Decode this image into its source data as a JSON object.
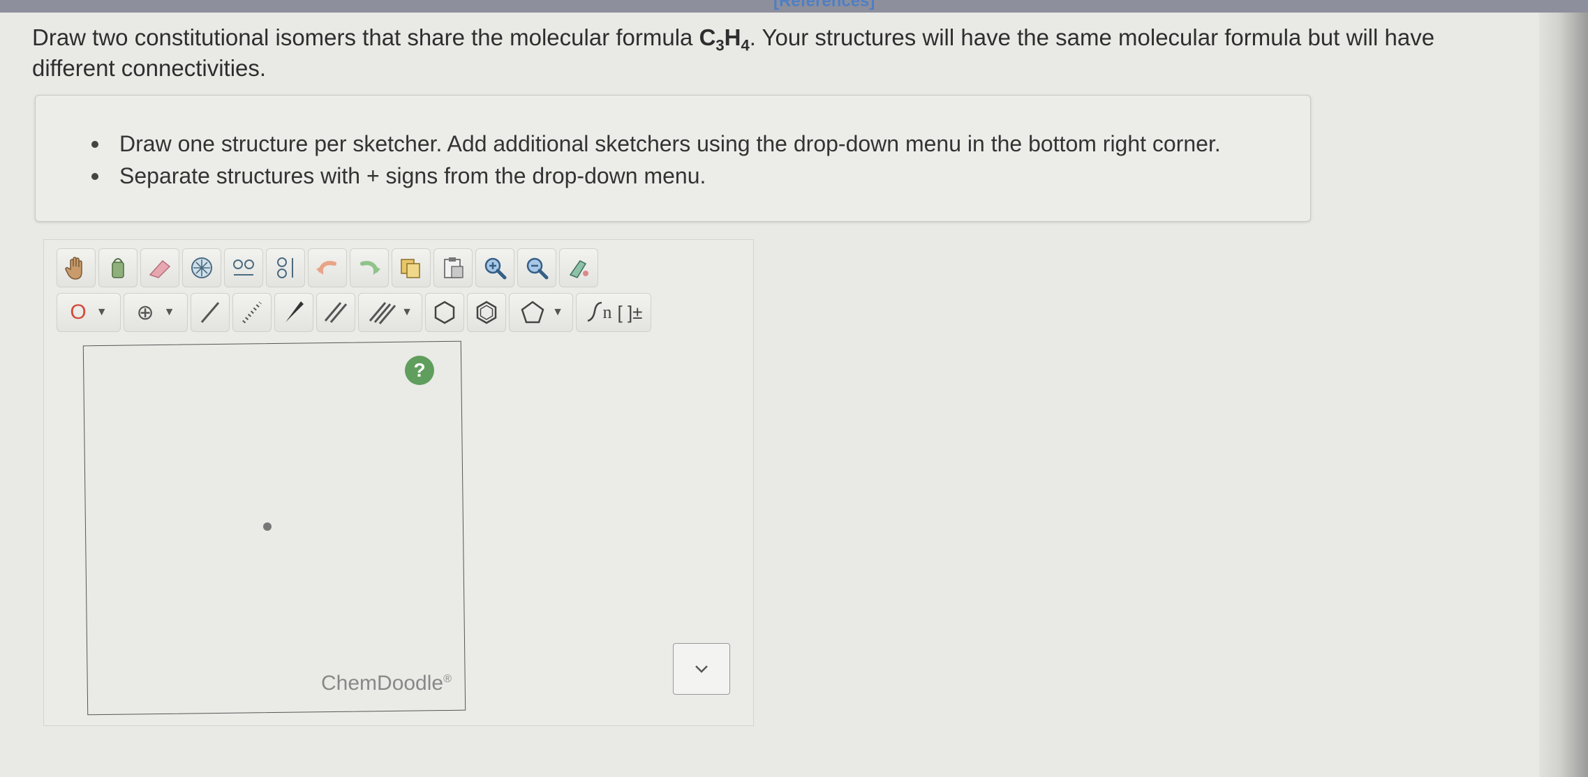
{
  "header": {
    "references_label": "[References]"
  },
  "prompt": {
    "part1": "Draw two constitutional isomers that share the molecular formula ",
    "formula_c": "C",
    "formula_c_sub": "3",
    "formula_h": "H",
    "formula_h_sub": "4",
    "part2": ". Your structures will have the same molecular formula but will have different connectivities."
  },
  "hints": [
    "Draw one structure per sketcher. Add additional sketchers using the drop-down menu in the bottom right corner.",
    "Separate structures with + signs from the drop-down menu."
  ],
  "toolbar": {
    "atom_label": "O",
    "charge_label": "⊕",
    "template_n_label": "n",
    "bracket_label": "[ ]±"
  },
  "sketcher": {
    "help_label": "?",
    "brand": "ChemDoodle",
    "brand_mark": "®"
  },
  "icons": {
    "hand": "hand-icon",
    "lasso": "lasso-icon",
    "eraser": "eraser-icon",
    "center": "center-icon",
    "flip_h": "flip-horizontal-icon",
    "flip_v": "flip-vertical-icon",
    "undo": "undo-icon",
    "redo": "redo-icon",
    "copy": "copy-icon",
    "paste": "paste-icon",
    "zoom_in": "zoom-in-icon",
    "zoom_out": "zoom-out-icon",
    "clean": "clean-icon",
    "bond_single": "single-bond-icon",
    "bond_wedge_dashed": "dashed-wedge-bond-icon",
    "bond_wedge": "wedge-bond-icon",
    "bond_double": "double-bond-icon",
    "bond_triple": "triple-bond-icon",
    "ring_cyclohexane": "cyclohexane-icon",
    "ring_benzene": "benzene-icon",
    "ring_cyclopentane": "cyclopentane-icon",
    "chevron": "chevron-down-icon"
  },
  "colors": {
    "accent_link": "#4f7fc4",
    "help_green": "#5f9e5c",
    "oxygen_red": "#d24a3a"
  }
}
